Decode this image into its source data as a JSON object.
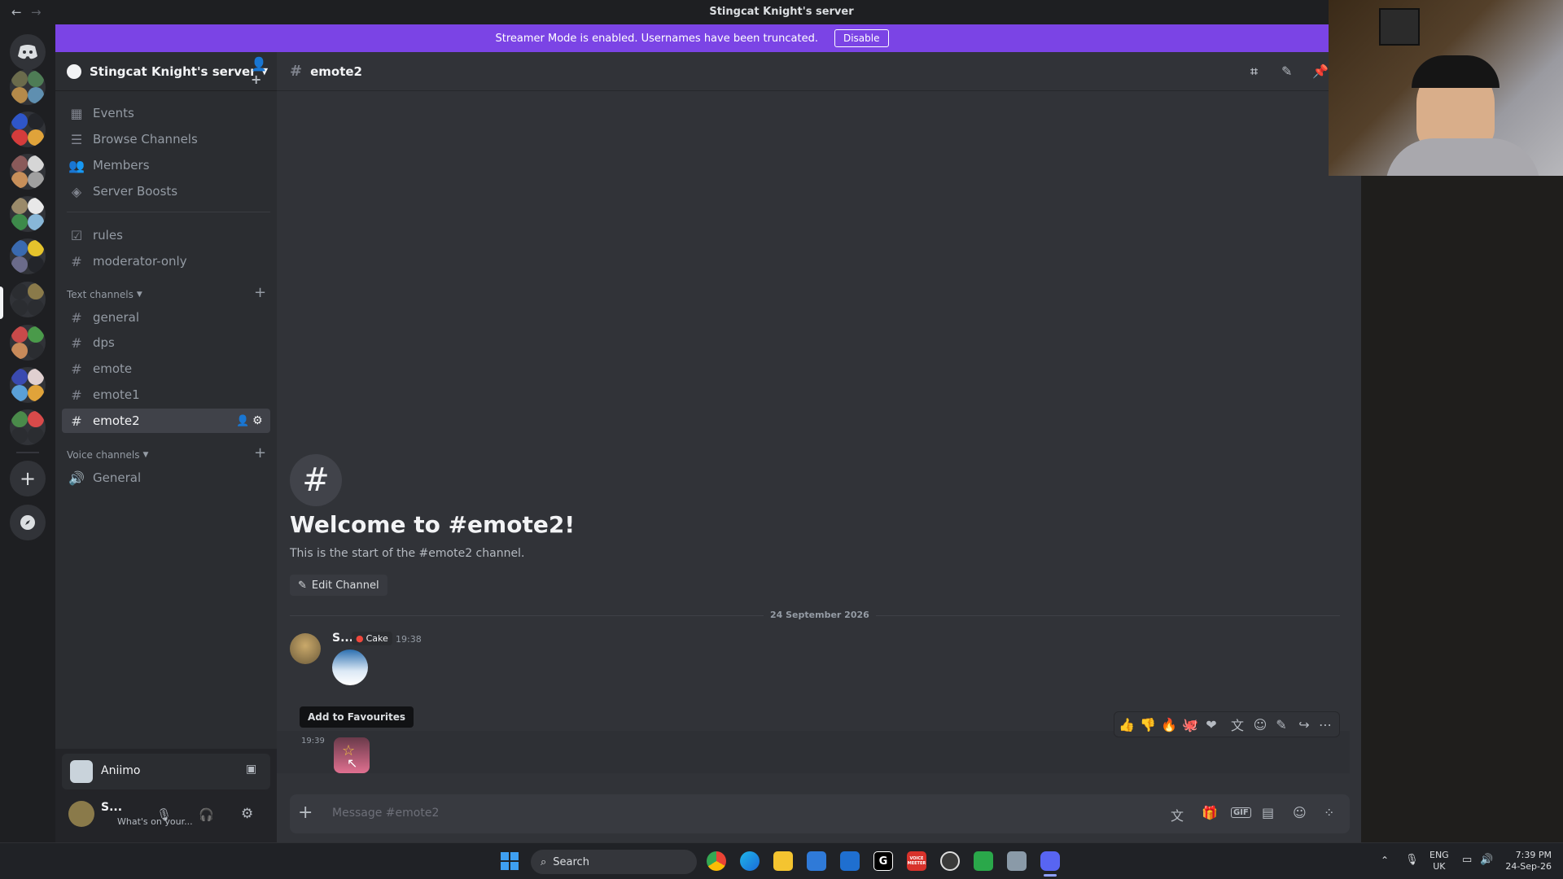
{
  "titlebar": {
    "title": "Stingcat Knight's server",
    "back": "←",
    "forward": "→"
  },
  "banner": {
    "text": "Streamer Mode is enabled. Usernames have been truncated.",
    "disable_label": "Disable"
  },
  "server": {
    "name": "Stingcat Knight's server"
  },
  "sidebar": {
    "top_items": [
      {
        "label": "Events",
        "icon": "calendar-icon"
      },
      {
        "label": "Browse Channels",
        "icon": "browse-channels-icon"
      },
      {
        "label": "Members",
        "icon": "members-icon"
      },
      {
        "label": "Server Boosts",
        "icon": "boost-icon"
      }
    ],
    "pinned_channels": [
      {
        "label": "rules",
        "icon": "rules-icon"
      },
      {
        "label": "moderator-only",
        "icon": "hash-icon"
      }
    ],
    "text_category": "Text channels",
    "text_channels": [
      "general",
      "dps",
      "emote",
      "emote1",
      "emote2"
    ],
    "active_channel": "emote2",
    "voice_category": "Voice channels",
    "voice_channels": [
      "General"
    ]
  },
  "activity": {
    "name": "Aniimo"
  },
  "user": {
    "name": "S...",
    "status": "What's on your..."
  },
  "channel": {
    "name": "emote2",
    "welcome_title": "Welcome to #emote2!",
    "welcome_sub": "This is the start of the #emote2 channel.",
    "edit_label": "Edit Channel",
    "date_divider": "24 September 2026",
    "message": {
      "author": "S...",
      "tag": "Cake",
      "time": "19:38",
      "time2": "19:39"
    },
    "tooltip": "Add to Favourites",
    "composer_placeholder": "Message #emote2"
  },
  "taskbar": {
    "search_label": "Search",
    "lang_line1": "ENG",
    "lang_line2": "UK",
    "time": "7:39 PM",
    "date": "24-Sep-26",
    "voicemeeter_label": "VOICE MEETER",
    "g_label": "G"
  },
  "colors": {
    "accent": "#7b44e5",
    "bg_main": "#313338",
    "bg_sidebar": "#2b2d31",
    "bg_server_rail": "#1e1f22"
  }
}
